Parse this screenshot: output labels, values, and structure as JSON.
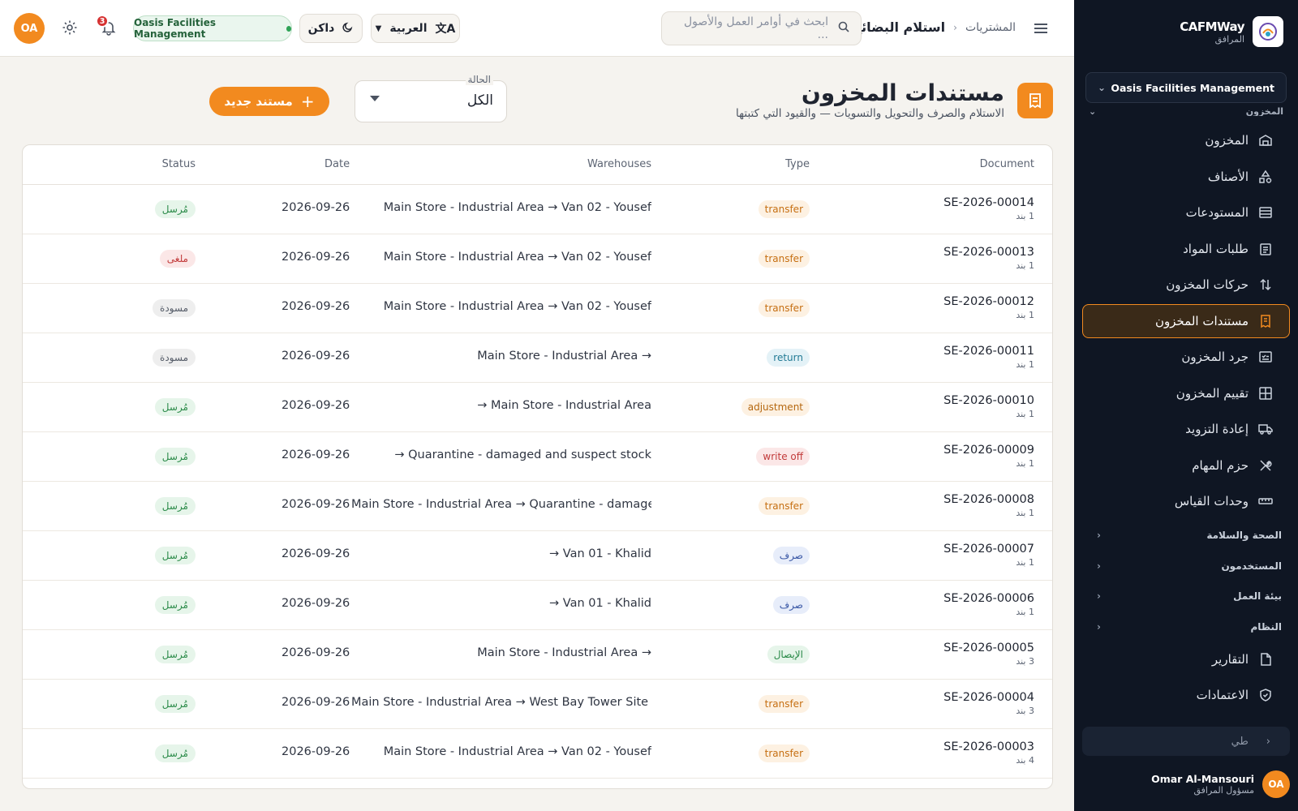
{
  "sidebar": {
    "brand_name": "CAFMWay",
    "brand_sub": "المرافق",
    "org": "Oasis Facilities Management",
    "group_cut_label": "المخزون",
    "items": [
      {
        "label": "المخزون",
        "icon": "warehouse-icon"
      },
      {
        "label": "الأصناف",
        "icon": "shapes-icon"
      },
      {
        "label": "المستودعات",
        "icon": "store-icon"
      },
      {
        "label": "طلبات المواد",
        "icon": "clipboard-icon"
      },
      {
        "label": "حركات المخزون",
        "icon": "arrows-updown-icon"
      },
      {
        "label": "مستندات المخزون",
        "icon": "receipt-icon",
        "active": true
      },
      {
        "label": "جرد المخزون",
        "icon": "checklist-icon"
      },
      {
        "label": "تقييم المخزون",
        "icon": "calculator-icon"
      },
      {
        "label": "إعادة التزويد",
        "icon": "truck-icon"
      },
      {
        "label": "حزم المهام",
        "icon": "tools-icon"
      },
      {
        "label": "وحدات القياس",
        "icon": "ruler-icon"
      }
    ],
    "groups": [
      "الصحة والسلامة",
      "المستخدمون",
      "بيئة العمل",
      "النظام"
    ],
    "bottom_items": [
      {
        "label": "التقارير",
        "icon": "report-icon"
      },
      {
        "label": "الاعتمادات",
        "icon": "shield-check-icon"
      }
    ],
    "collapse_label": "طي",
    "user_name": "Omar Al-Mansouri",
    "user_role": "مسؤول المرافق",
    "user_initials": "OA"
  },
  "topbar": {
    "crumb_parent": "المشتريات",
    "crumb_current": "استلام البضائع",
    "search_placeholder": "ابحث في أوامر العمل والأصول ...",
    "language": "العربية",
    "theme": "داكن",
    "org": "Oasis Facilities Management",
    "notifications": "3",
    "initials": "OA"
  },
  "page": {
    "title": "مستندات المخزون",
    "subtitle": "الاستلام والصرف والتحويل والتسويات — والقيود التي كتبتها",
    "status_label": "الحالة",
    "status_value": "الكل",
    "new_button": "مستند جديد"
  },
  "table": {
    "headers": {
      "document": "Document",
      "type": "Type",
      "warehouses": "Warehouses",
      "date": "Date",
      "status": "Status"
    },
    "rows": [
      {
        "doc": "SE-2026-00014",
        "lines": "1 بند",
        "type": "transfer",
        "type_class": "type-transfer",
        "wh": "Main Store - Industrial Area → Van 02 - Yousef",
        "date": "2026-09-26",
        "status": "مُرسل",
        "status_class": "st-posted"
      },
      {
        "doc": "SE-2026-00013",
        "lines": "1 بند",
        "type": "transfer",
        "type_class": "type-transfer",
        "wh": "Main Store - Industrial Area → Van 02 - Yousef",
        "date": "2026-09-26",
        "status": "ملغى",
        "status_class": "st-cancel"
      },
      {
        "doc": "SE-2026-00012",
        "lines": "1 بند",
        "type": "transfer",
        "type_class": "type-transfer",
        "wh": "Main Store - Industrial Area → Van 02 - Yousef",
        "date": "2026-09-26",
        "status": "مسودة",
        "status_class": "st-draft"
      },
      {
        "doc": "SE-2026-00011",
        "lines": "1 بند",
        "type": "return",
        "type_class": "type-return",
        "wh": "Main Store - Industrial Area →",
        "date": "2026-09-26",
        "status": "مسودة",
        "status_class": "st-draft"
      },
      {
        "doc": "SE-2026-00010",
        "lines": "1 بند",
        "type": "adjustment",
        "type_class": "type-adjustment",
        "wh": "→ Main Store - Industrial Area",
        "date": "2026-09-26",
        "status": "مُرسل",
        "status_class": "st-posted"
      },
      {
        "doc": "SE-2026-00009",
        "lines": "1 بند",
        "type": "write off",
        "type_class": "type-writeoff",
        "wh": "→ Quarantine - damaged and suspect stock",
        "date": "2026-09-26",
        "status": "مُرسل",
        "status_class": "st-posted"
      },
      {
        "doc": "SE-2026-00008",
        "lines": "1 بند",
        "type": "transfer",
        "type_class": "type-transfer",
        "wh": "Main Store - Industrial Area → Quarantine - damaged and...",
        "date": "2026-09-26",
        "status": "مُرسل",
        "status_class": "st-posted"
      },
      {
        "doc": "SE-2026-00007",
        "lines": "1 بند",
        "type": "صرف",
        "type_class": "type-issue",
        "wh": "→ Van 01 - Khalid",
        "date": "2026-09-26",
        "status": "مُرسل",
        "status_class": "st-posted"
      },
      {
        "doc": "SE-2026-00006",
        "lines": "1 بند",
        "type": "صرف",
        "type_class": "type-issue",
        "wh": "→ Van 01 - Khalid",
        "date": "2026-09-26",
        "status": "مُرسل",
        "status_class": "st-posted"
      },
      {
        "doc": "SE-2026-00005",
        "lines": "3 بند",
        "type": "الإيصال",
        "type_class": "type-receipt",
        "wh": "Main Store - Industrial Area →",
        "date": "2026-09-26",
        "status": "مُرسل",
        "status_class": "st-posted"
      },
      {
        "doc": "SE-2026-00004",
        "lines": "3 بند",
        "type": "transfer",
        "type_class": "type-transfer",
        "wh": "Main Store - Industrial Area → West Bay Tower Site Store",
        "date": "2026-09-26",
        "status": "مُرسل",
        "status_class": "st-posted"
      },
      {
        "doc": "SE-2026-00003",
        "lines": "4 بند",
        "type": "transfer",
        "type_class": "type-transfer",
        "wh": "Main Store - Industrial Area → Van 02 - Yousef",
        "date": "2026-09-26",
        "status": "مُرسل",
        "status_class": "st-posted"
      }
    ]
  },
  "colors": {
    "accent": "#f28a1f",
    "sidebar_bg": "#0f1623",
    "page_bg": "#f5f3ef"
  }
}
